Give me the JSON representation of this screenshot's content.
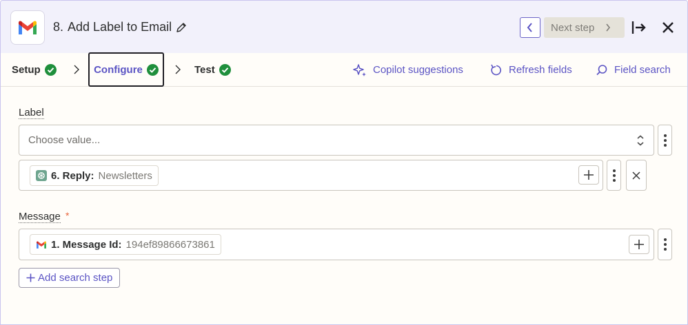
{
  "header": {
    "step_number": "8.",
    "title": "Add Label to Email",
    "next_label": "Next step"
  },
  "tabs": [
    {
      "label": "Setup",
      "status": "complete"
    },
    {
      "label": "Configure",
      "status": "complete"
    },
    {
      "label": "Test",
      "status": "complete"
    }
  ],
  "toolbar": {
    "copilot": "Copilot suggestions",
    "refresh": "Refresh fields",
    "search": "Field search"
  },
  "fields": {
    "label": {
      "title": "Label",
      "placeholder": "Choose value...",
      "mapped": {
        "step": "6. Reply:",
        "value": "Newsletters",
        "icon": "chatgpt-icon"
      }
    },
    "message": {
      "title": "Message",
      "required_mark": "*",
      "mapped": {
        "step": "1. Message Id:",
        "value": "194ef89866673861",
        "icon": "gmail-icon"
      }
    }
  },
  "add_search_step": "Add search step",
  "colors": {
    "accent": "#5b54c4",
    "check_green": "#1f8f3c",
    "header_bg": "#f2f1fb",
    "required": "#e8633a"
  }
}
